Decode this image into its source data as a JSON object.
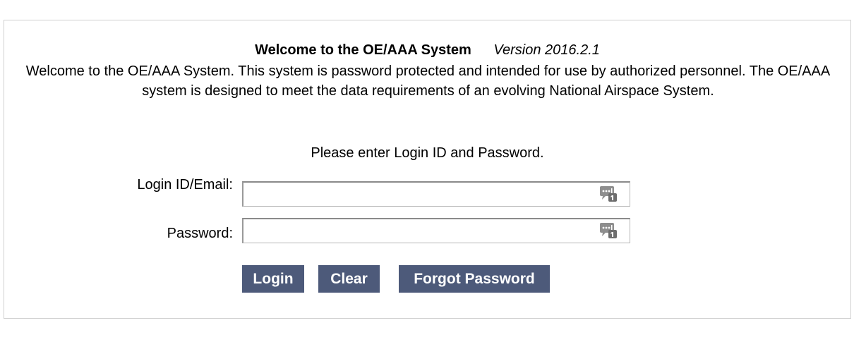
{
  "header": {
    "title": "Welcome to the OE/AAA System",
    "version": "Version 2016.2.1"
  },
  "intro": {
    "text": "Welcome to the OE/AAA System. This system is password protected and intended for use by authorized personnel. The OE/AAA system is designed to meet the data requirements of an evolving National Airspace System."
  },
  "login_form": {
    "prompt": "Please enter Login ID and Password.",
    "login_label": "Login ID/Email:",
    "login_value": "",
    "password_label": "Password:",
    "password_value": "",
    "keychain_icon": "password-manager-icon",
    "buttons": {
      "login": "Login",
      "clear": "Clear",
      "forgot": "Forgot Password"
    }
  },
  "colors": {
    "button_bg": "#4d5a7a",
    "button_text": "#ffffff",
    "panel_border": "#d0d0d0"
  }
}
